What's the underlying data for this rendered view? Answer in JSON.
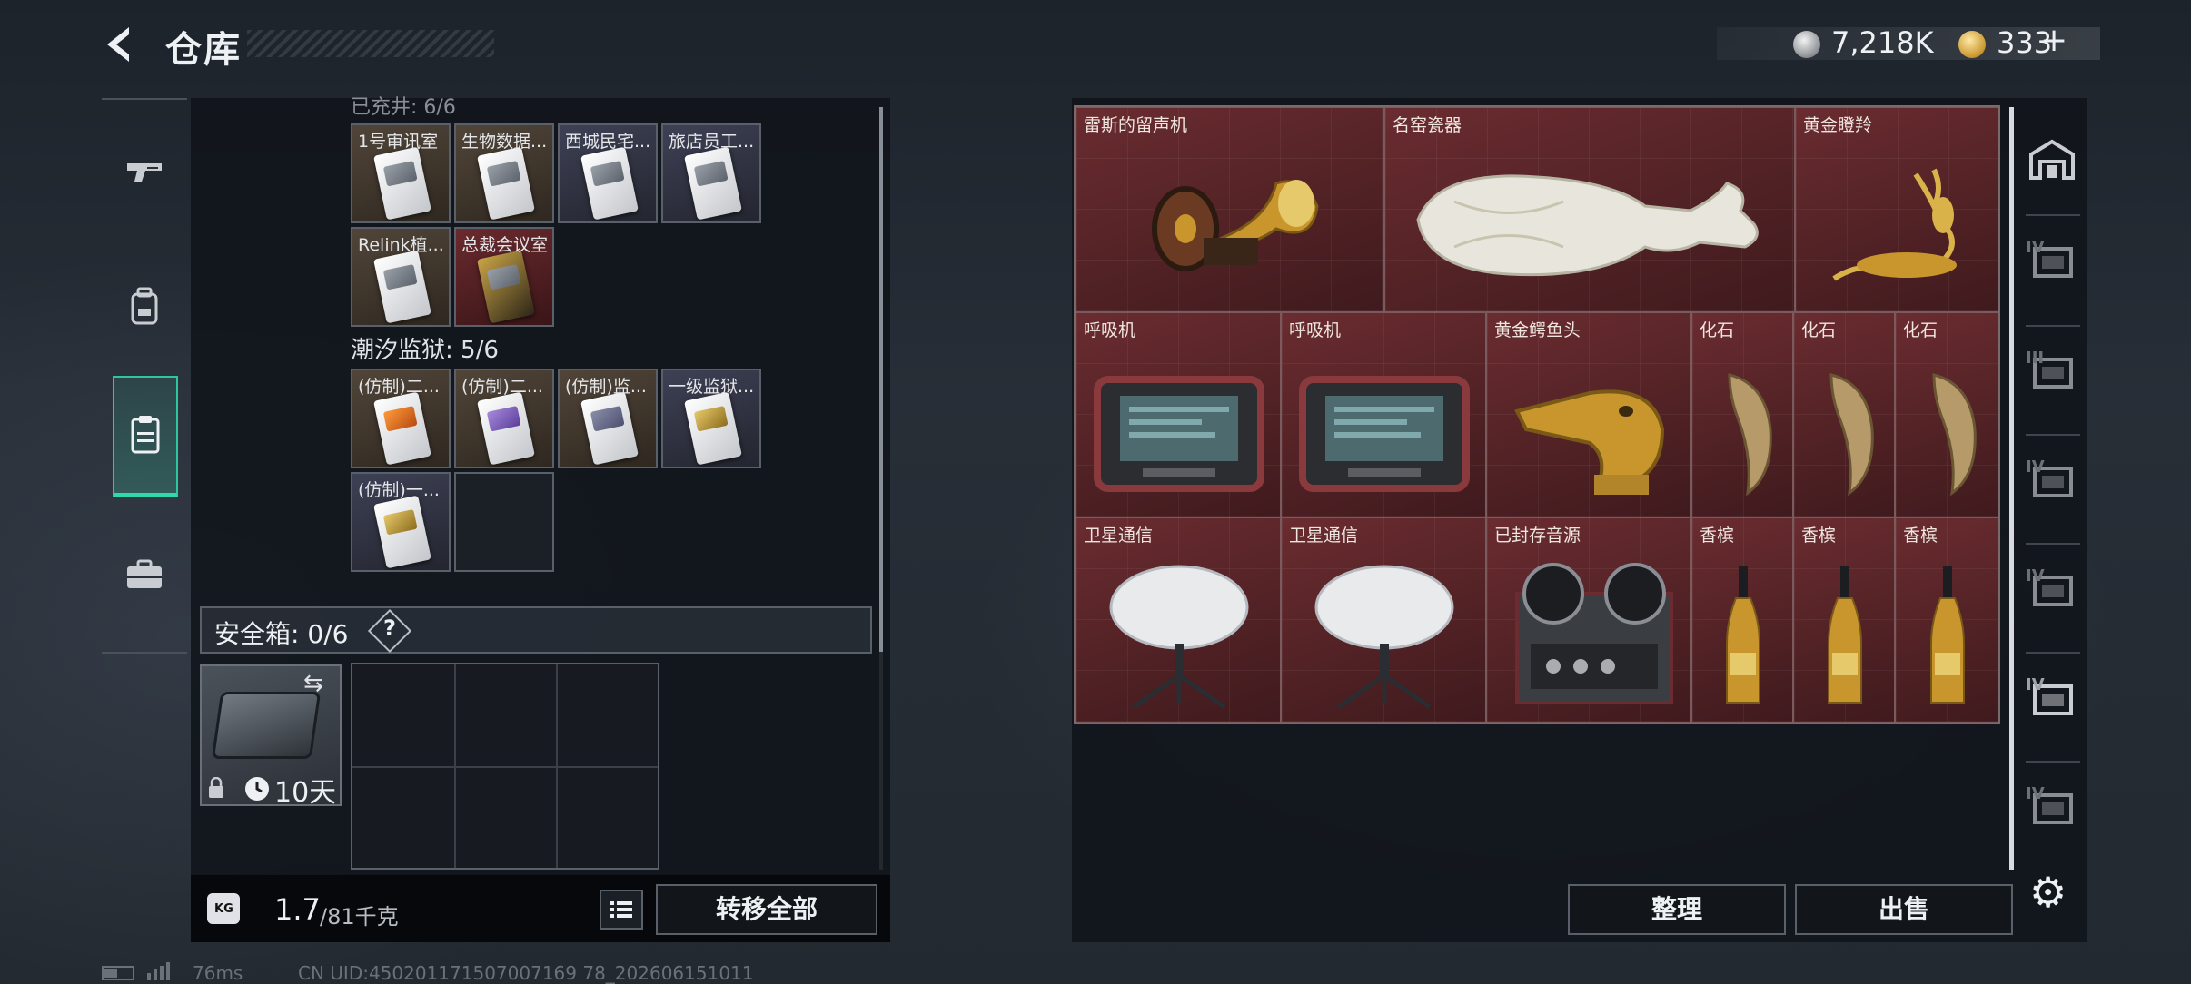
{
  "header": {
    "title": "仓库",
    "silver_amount": "7,218K",
    "gold_amount": "333",
    "gold_plus": "+"
  },
  "left_nav": {
    "items": [
      {
        "name": "weapon",
        "icon": "pistol-icon"
      },
      {
        "name": "gear",
        "icon": "backpack-icon"
      },
      {
        "name": "storage",
        "icon": "clipboard-icon",
        "selected": true
      },
      {
        "name": "case",
        "icon": "briefcase-icon"
      }
    ]
  },
  "keycards": {
    "clipped_label": "已充井: 6/6",
    "group1": [
      {
        "label": "1号审讯室",
        "bg": "brown"
      },
      {
        "label": "生物数据...",
        "bg": "brown"
      },
      {
        "label": "西城民宅...",
        "bg": "blue"
      },
      {
        "label": "旅店员工...",
        "bg": "blue"
      },
      {
        "label": "Relink植...",
        "bg": "brown"
      },
      {
        "label": "总裁会议室",
        "bg": "red"
      }
    ],
    "group2_title": "潮汐监狱: 5/6",
    "group2": [
      {
        "label": "(仿制)二...",
        "bg": "brown"
      },
      {
        "label": "(仿制)二...",
        "bg": "brown"
      },
      {
        "label": "(仿制)监...",
        "bg": "brown"
      },
      {
        "label": "一级监狱...",
        "bg": "blue"
      },
      {
        "label": "(仿制)一...",
        "bg": "blue"
      }
    ]
  },
  "safe_box": {
    "label": "安全箱:",
    "count": "0/6",
    "help": "?",
    "days": "10天"
  },
  "bottom": {
    "weight_current": "1.7",
    "weight_max": "/81千克",
    "weight_icon_text": "KG",
    "transfer_all": "转移全部",
    "sort": "整理",
    "sell": "出售"
  },
  "items": [
    {
      "label": "雷斯的留声机",
      "icon": "gramophone-icon"
    },
    {
      "label": "名窑瓷器",
      "icon": "porcelain-vase-icon"
    },
    {
      "label": "黄金瞪羚",
      "icon": "gold-gazelle-icon"
    },
    {
      "label": "呼吸机",
      "icon": "ventilator-icon"
    },
    {
      "label": "呼吸机",
      "icon": "ventilator-icon"
    },
    {
      "label": "黄金鳄鱼头",
      "icon": "gold-crocodile-head-icon"
    },
    {
      "label": "化石",
      "icon": "fossil-claw-icon"
    },
    {
      "label": "化石",
      "icon": "fossil-claw-icon"
    },
    {
      "label": "化石",
      "icon": "fossil-claw-icon"
    },
    {
      "label": "卫星通信",
      "icon": "satellite-dish-icon"
    },
    {
      "label": "卫星通信",
      "icon": "satellite-dish-icon"
    },
    {
      "label": "已封存音源",
      "icon": "reel-to-reel-icon"
    },
    {
      "label": "香槟",
      "icon": "champagne-icon"
    },
    {
      "label": "香槟",
      "icon": "champagne-icon"
    },
    {
      "label": "香槟",
      "icon": "champagne-icon"
    }
  ],
  "right_nav": {
    "labels": [
      "IV",
      "III",
      "IV",
      "IV",
      "IV",
      "IV"
    ]
  },
  "footer": {
    "ping": "76ms",
    "uid": "CN UID:450201171507007169 78_202606151011"
  },
  "colors": {
    "accent": "#2fc59f",
    "item_bg": "#5a2529",
    "panel_bg": "#10141a"
  }
}
